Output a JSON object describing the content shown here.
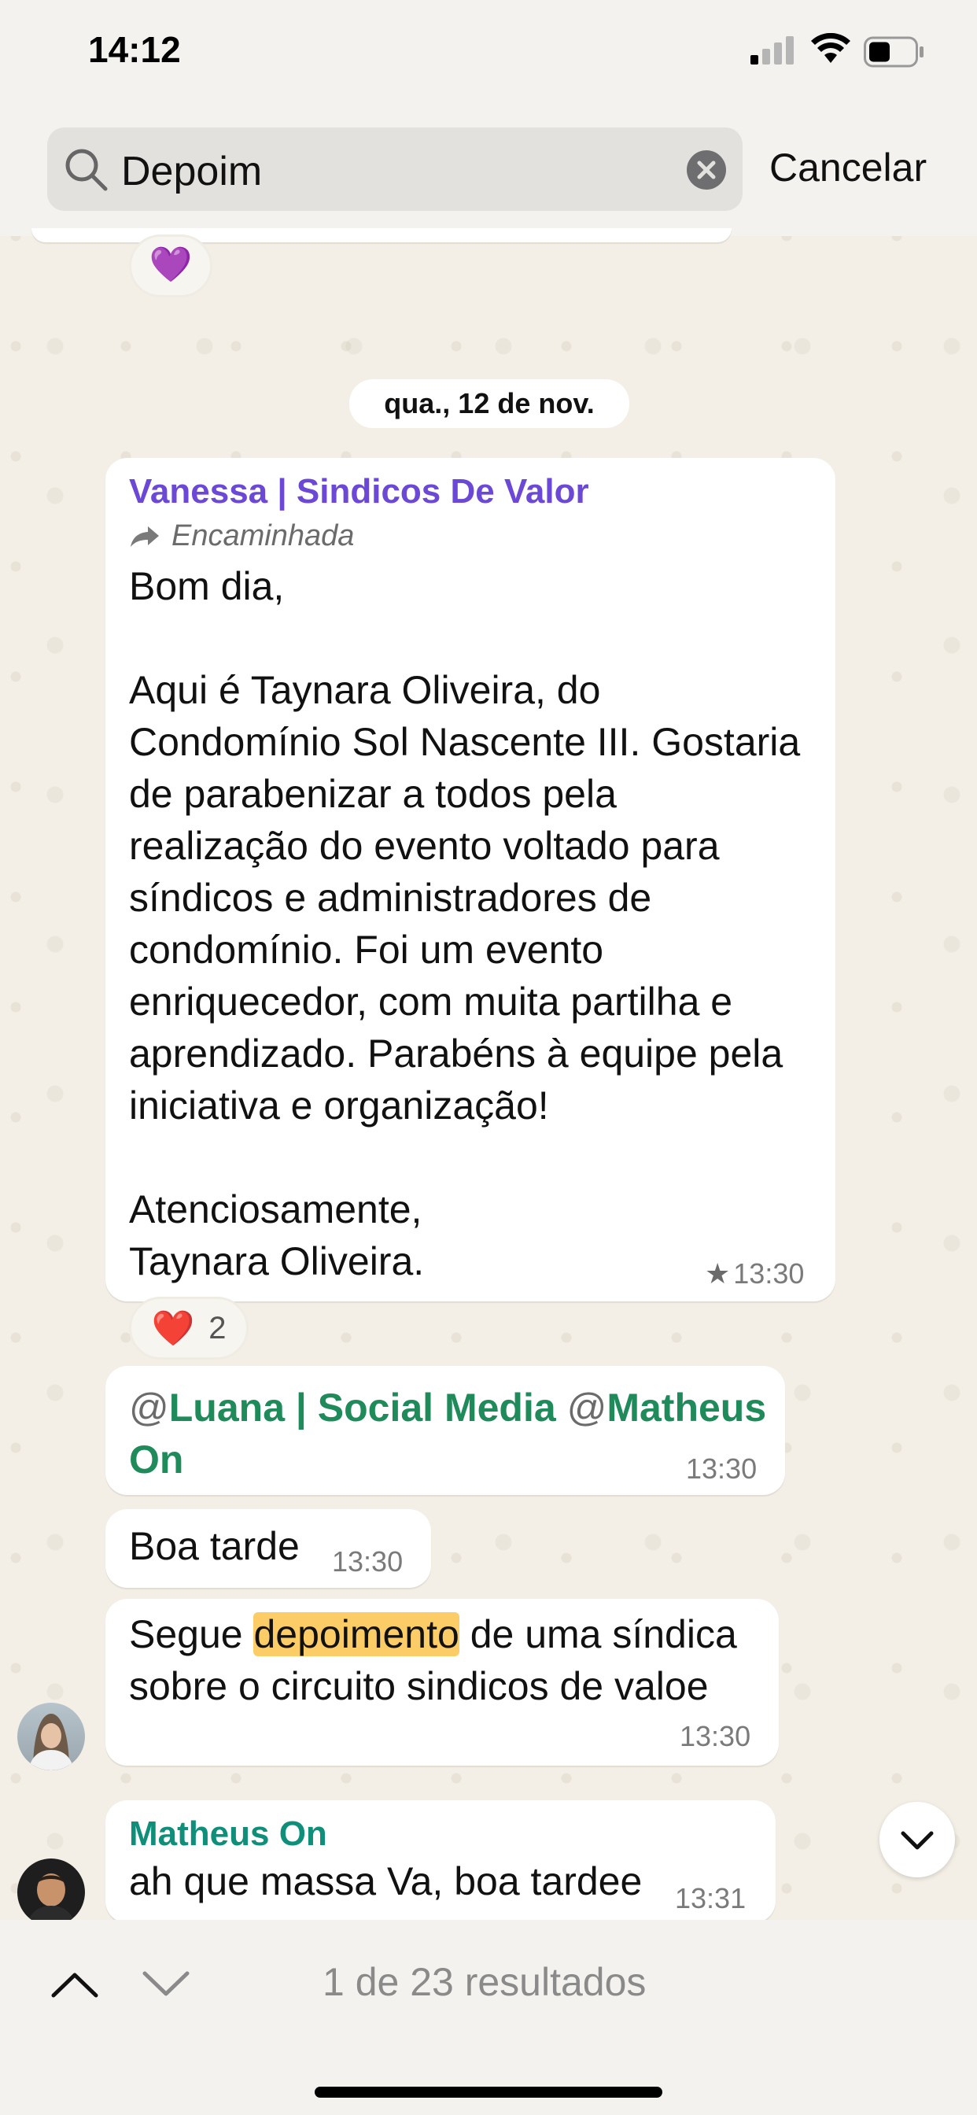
{
  "status": {
    "time": "14:12"
  },
  "search": {
    "query": "Depoim",
    "cancel_label": "Cancelar"
  },
  "top_reaction": {
    "emoji": "💜"
  },
  "date_chip": "qua., 12 de nov.",
  "messages": {
    "m1": {
      "sender": "Vanessa | Sindicos De Valor",
      "forwarded_label": "Encaminhada",
      "text": "Bom dia,\n\nAqui é Taynara Oliveira, do\nCondomínio Sol Nascente III. Gostaria\nde parabenizar a todos pela\nrealização do evento voltado para\nsíndicos e administradores de\ncondomínio. Foi um evento\nenriquecedor, com muita partilha e\naprendizado. Parabéns à equipe pela\niniciativa e organização!\n\nAtenciosamente,\nTaynara Oliveira.",
      "time": "13:30",
      "starred": true,
      "reaction_emoji": "❤️",
      "reaction_count": "2"
    },
    "m2": {
      "at1": "@",
      "mention1": "Luana | Social Media",
      "at2": "@",
      "mention2": "Matheus",
      "mention2_cont": "On",
      "time": "13:30"
    },
    "m3": {
      "text": "Boa tarde",
      "time": "13:30"
    },
    "m4": {
      "pre": "Segue ",
      "highlight": "depoimento",
      "post": " de uma síndica",
      "line2": "sobre o circuito sindicos de valoe",
      "time": "13:30"
    },
    "m5": {
      "sender": "Matheus On",
      "text": "ah que massa Va, boa tardee",
      "time": "13:31"
    }
  },
  "footer": {
    "results": "1 de 23 resultados"
  },
  "colors": {
    "accent_purple": "#6b48d6",
    "accent_green": "#1f8a5a",
    "teal_sender": "#0f8f7a",
    "highlight": "#fccd66",
    "wallpaper": "#f3efe6"
  }
}
